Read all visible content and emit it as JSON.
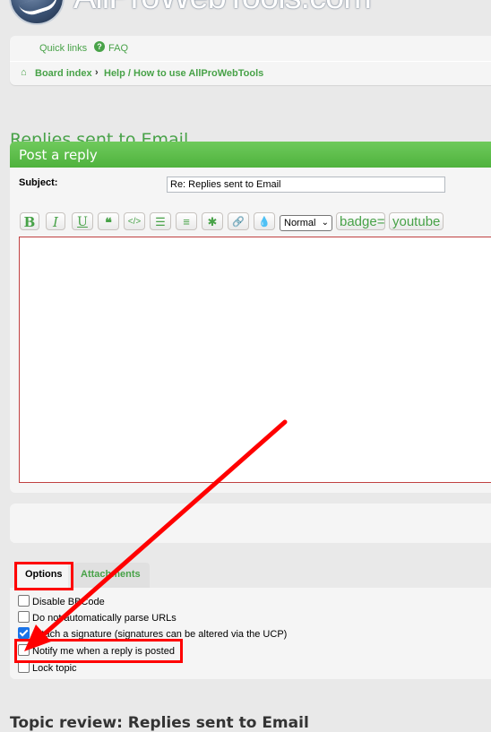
{
  "site": {
    "logo_text": "AllProWebTools.com"
  },
  "navbar": {
    "quick_links": "Quick links",
    "faq": "FAQ",
    "breadcrumbs": [
      "Board index",
      "Help / How to use AllProWebTools"
    ]
  },
  "page": {
    "title": "Replies sent to Email"
  },
  "post_panel": {
    "header": "Post a reply",
    "subject_label": "Subject:",
    "subject_value": "Re: Replies sent to Email",
    "toolbar": {
      "bold": "B",
      "italic": "I",
      "underline": "U",
      "quote": "❝",
      "code": "</>",
      "list": "☰",
      "list_numbered": "≡",
      "list_item": "✱",
      "link": "🔗",
      "color": "💧",
      "font_size": "Normal",
      "badge": "badge=",
      "youtube": "youtube"
    },
    "message": ""
  },
  "tabs": [
    "Options",
    "Attachments"
  ],
  "options": [
    {
      "label": "Disable BBCode",
      "checked": false
    },
    {
      "label": "Do not automatically parse URLs",
      "checked": false
    },
    {
      "label": "Attach a signature (signatures can be altered via the UCP)",
      "checked": true
    },
    {
      "label": "Notify me when a reply is posted",
      "checked": false
    },
    {
      "label": "Lock topic",
      "checked": false
    }
  ],
  "topic_review": {
    "title": "Topic review: Replies sent to Email"
  },
  "colors": {
    "accent": "#48a248",
    "header_green": "#5fbf4d",
    "annotation_red": "#ff0000"
  }
}
